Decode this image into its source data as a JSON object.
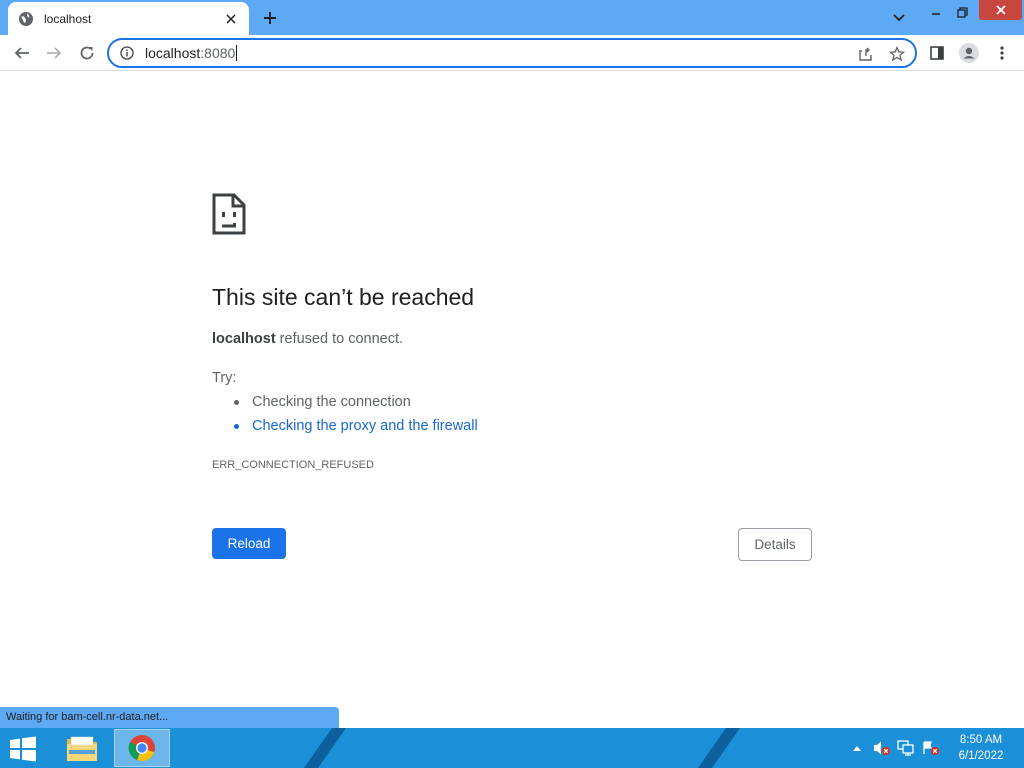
{
  "tab": {
    "title": "localhost",
    "favicon": "globe-icon"
  },
  "toolbar": {
    "url_host": "localhost",
    "url_port": ":8080",
    "icons": [
      "back-icon",
      "forward-icon",
      "reload-icon",
      "info-icon",
      "share-icon",
      "star-icon",
      "side-panel-icon",
      "profile-icon",
      "menu-icon"
    ]
  },
  "error": {
    "title": "This site can’t be reached",
    "host": "localhost",
    "description": " refused to connect.",
    "try_label": "Try:",
    "suggestions": [
      "Checking the connection",
      "Checking the proxy and the firewall"
    ],
    "code": "ERR_CONNECTION_REFUSED",
    "reload_label": "Reload",
    "details_label": "Details"
  },
  "status_bar": {
    "text": "Waiting for bam-cell.nr-data.net..."
  },
  "taskbar": {
    "time": "8:50 AM",
    "date": "6/1/2022",
    "apps": [
      "file-explorer-icon",
      "chrome-icon"
    ]
  },
  "colors": {
    "tabstrip": "#5ea9f3",
    "accent": "#1a73e8",
    "taskbar": "#1b8fd8",
    "close": "#c7463e"
  }
}
